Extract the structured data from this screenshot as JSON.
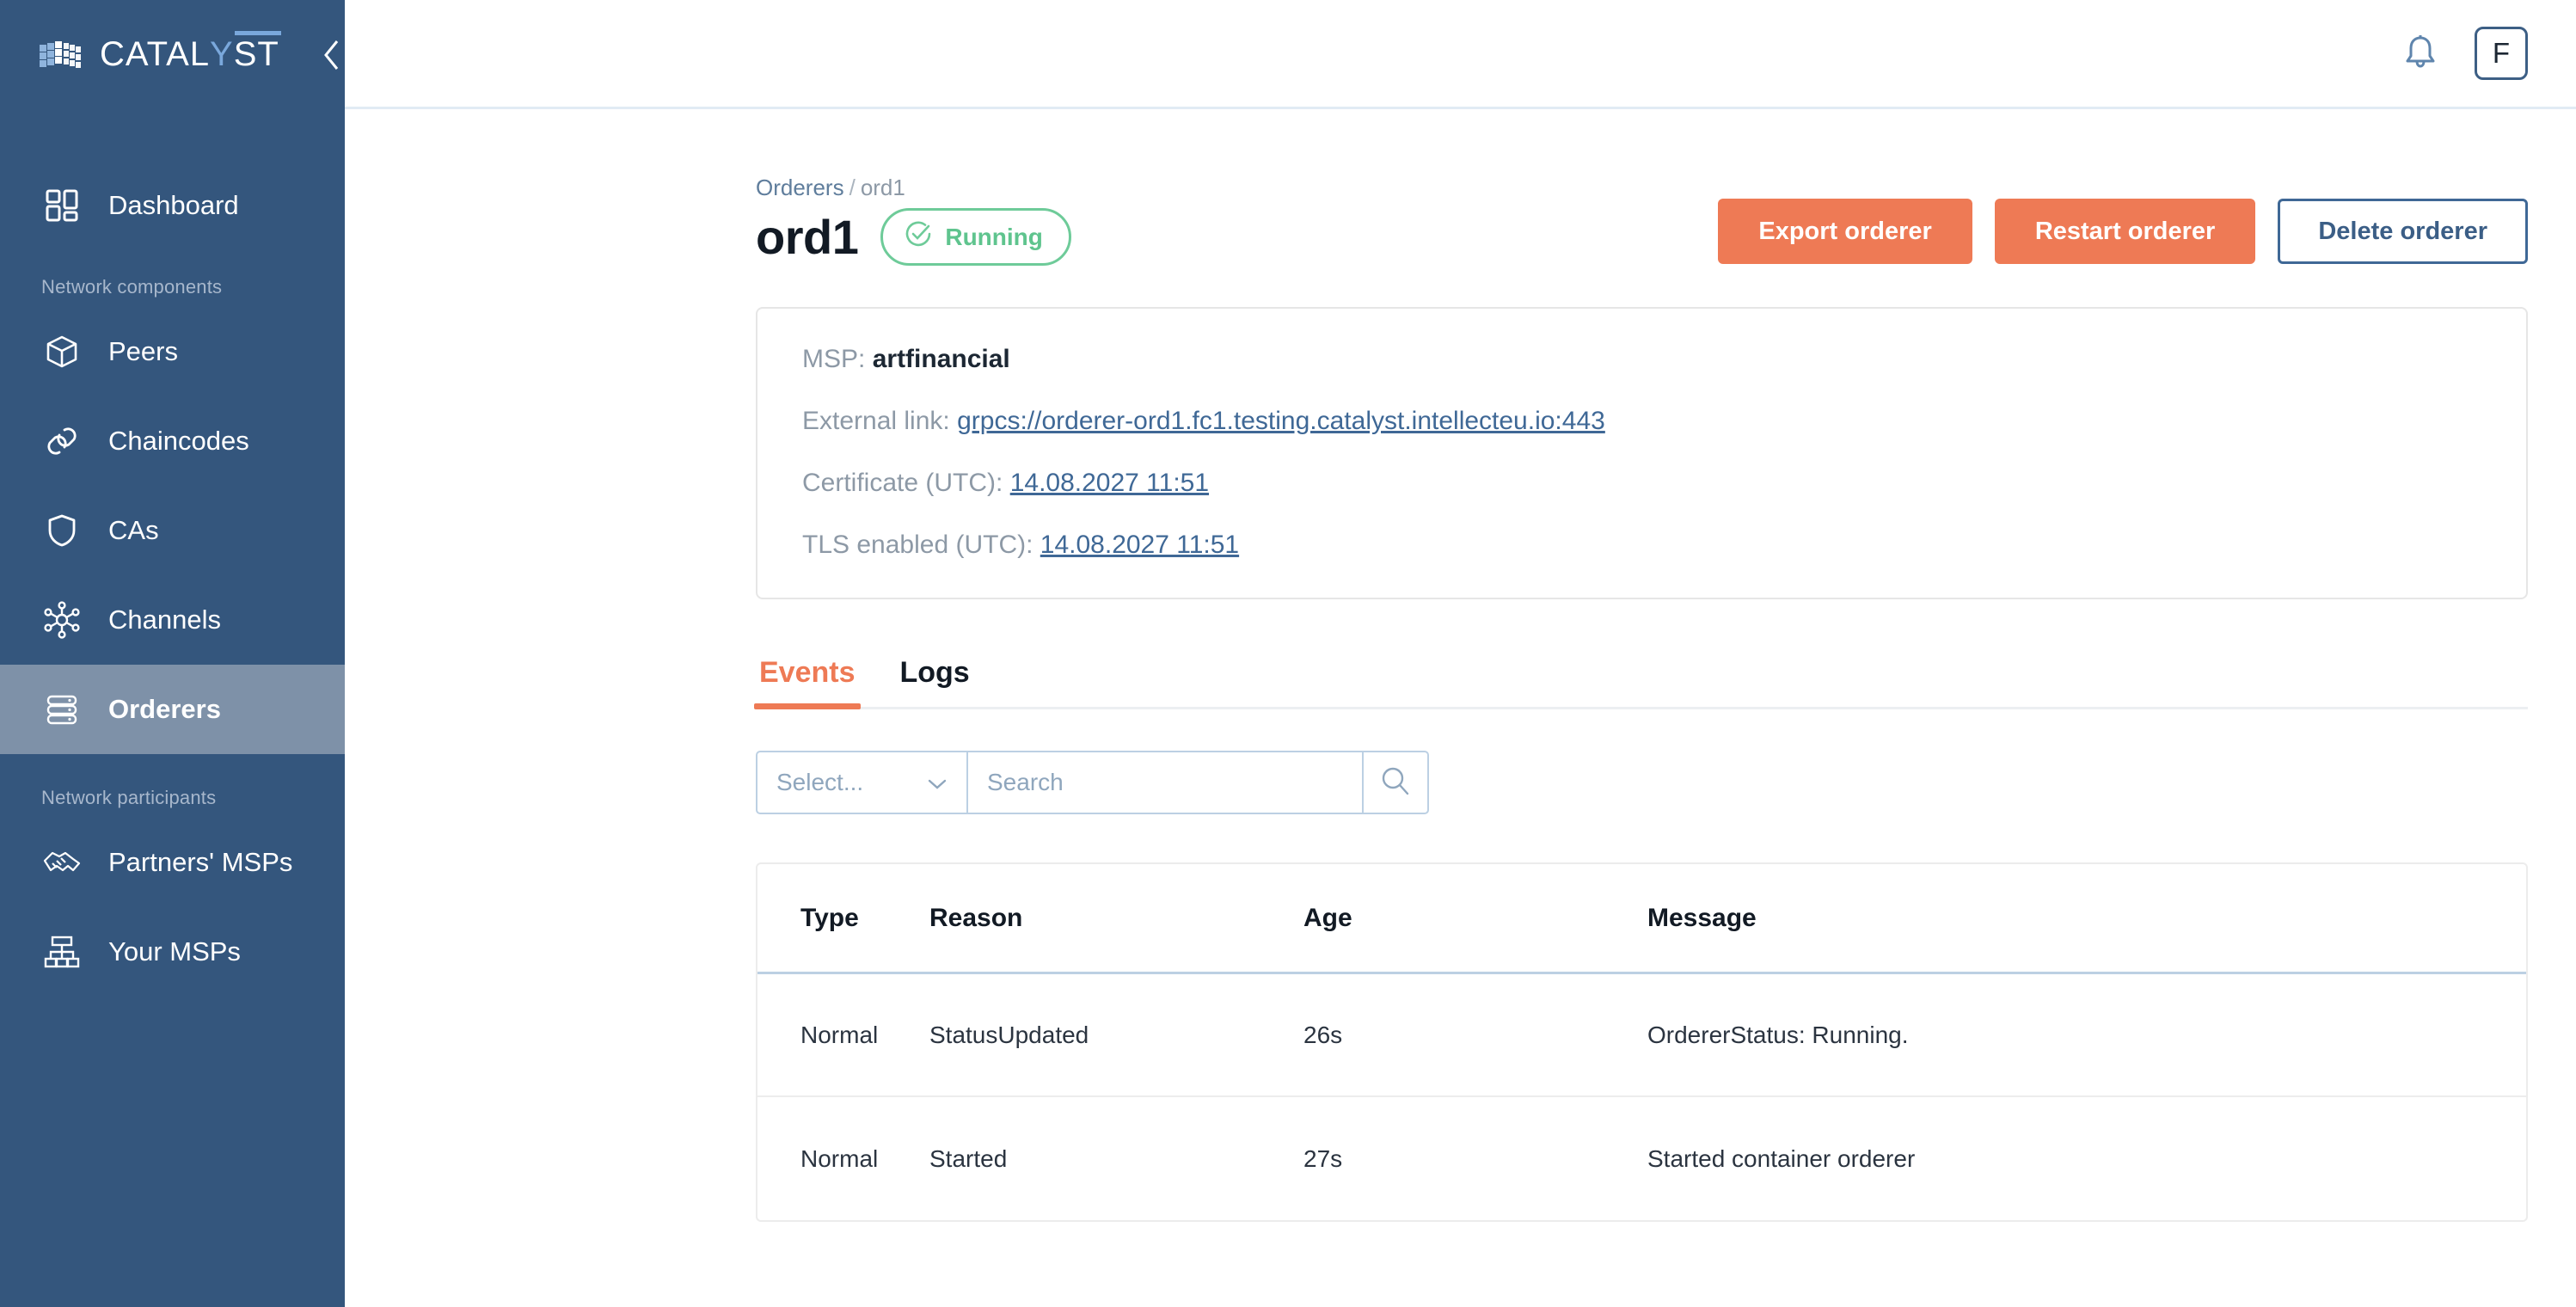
{
  "sidebar": {
    "brand": {
      "name_part1": "CATAL",
      "name_y": "Y",
      "name_part2": "ST",
      "logo_icon": "cube-grid-icon",
      "collapse_icon": "chevron-left-icon"
    },
    "groups": [
      {
        "label": "",
        "items": [
          {
            "label": "Dashboard",
            "icon": "layout-grid-icon",
            "active": false
          }
        ]
      },
      {
        "label": "Network components",
        "items": [
          {
            "label": "Peers",
            "icon": "cube-icon",
            "active": false
          },
          {
            "label": "Chaincodes",
            "icon": "link-chain-icon",
            "active": false
          },
          {
            "label": "CAs",
            "icon": "shield-icon",
            "active": false
          },
          {
            "label": "Channels",
            "icon": "network-hub-icon",
            "active": false
          },
          {
            "label": "Orderers",
            "icon": "server-stack-icon",
            "active": true
          }
        ]
      },
      {
        "label": "Network participants",
        "items": [
          {
            "label": "Partners' MSPs",
            "icon": "handshake-icon",
            "active": false
          },
          {
            "label": "Your MSPs",
            "icon": "org-chart-icon",
            "active": false
          }
        ]
      }
    ]
  },
  "topbar": {
    "bell_icon": "notification-bell-icon",
    "avatar_initial": "F"
  },
  "page": {
    "breadcrumb": {
      "parent": "Orderers",
      "separator": "/",
      "current": "ord1"
    },
    "title": "ord1",
    "status": {
      "label": "Running",
      "icon": "check-circle-icon",
      "color": "#6ecb99"
    },
    "actions": [
      {
        "label": "Export orderer",
        "style": "primary"
      },
      {
        "label": "Restart orderer",
        "style": "primary"
      },
      {
        "label": "Delete orderer",
        "style": "outline"
      }
    ]
  },
  "info": {
    "msp_label": "MSP:",
    "msp_value": "artfinancial",
    "external_link_label": "External link:",
    "external_link_value": "grpcs://orderer-ord1.fc1.testing.catalyst.intellecteu.io:443",
    "certificate_label": "Certificate (UTC):",
    "certificate_value": "14.08.2027 11:51",
    "tls_label": "TLS enabled (UTC):",
    "tls_value": "14.08.2027 11:51"
  },
  "tabs": [
    {
      "label": "Events",
      "active": true
    },
    {
      "label": "Logs",
      "active": false
    }
  ],
  "filters": {
    "select_placeholder": "Select...",
    "select_chevron_icon": "chevron-down-icon",
    "search_placeholder": "Search",
    "search_value": "",
    "search_icon": "search-icon"
  },
  "events_table": {
    "columns": [
      "Type",
      "Reason",
      "Age",
      "Message"
    ],
    "rows": [
      {
        "type": "Normal",
        "reason": "StatusUpdated",
        "age": "26s",
        "message": "OrdererStatus: Running."
      },
      {
        "type": "Normal",
        "reason": "Started",
        "age": "27s",
        "message": "Started container orderer"
      }
    ]
  },
  "colors": {
    "accent": "#ee7a55",
    "sidebar": "#34567d",
    "sidebar_active": "#7e91a8",
    "link": "#3f6896",
    "success": "#6ecb99"
  }
}
